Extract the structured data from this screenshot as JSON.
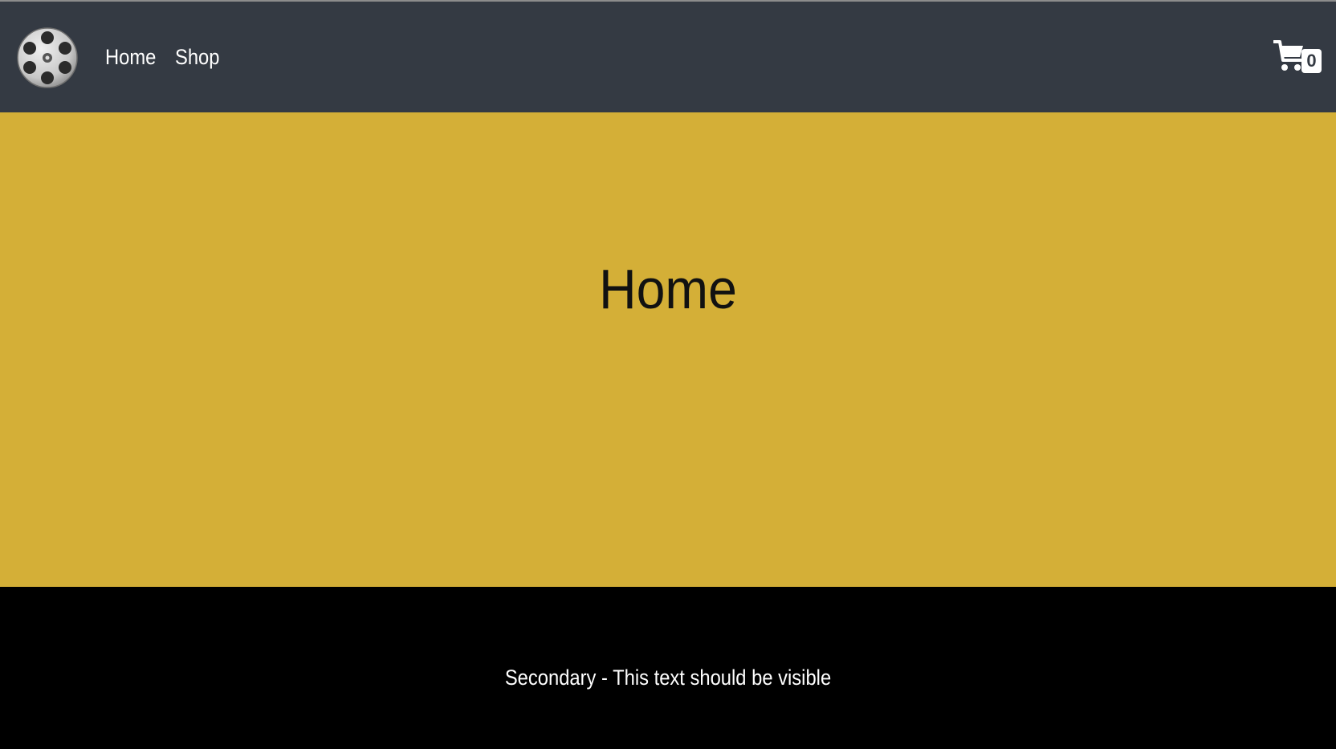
{
  "navbar": {
    "logo_icon": "film-reel-icon",
    "links": [
      {
        "label": "Home"
      },
      {
        "label": "Shop"
      }
    ],
    "cart": {
      "icon": "shopping-cart-icon",
      "count": "0"
    },
    "background_color": "#343a43"
  },
  "hero": {
    "title": "Home",
    "background_color": "#d4af37"
  },
  "footer": {
    "text": "Secondary - This text should be visible",
    "background_color": "#000000"
  }
}
